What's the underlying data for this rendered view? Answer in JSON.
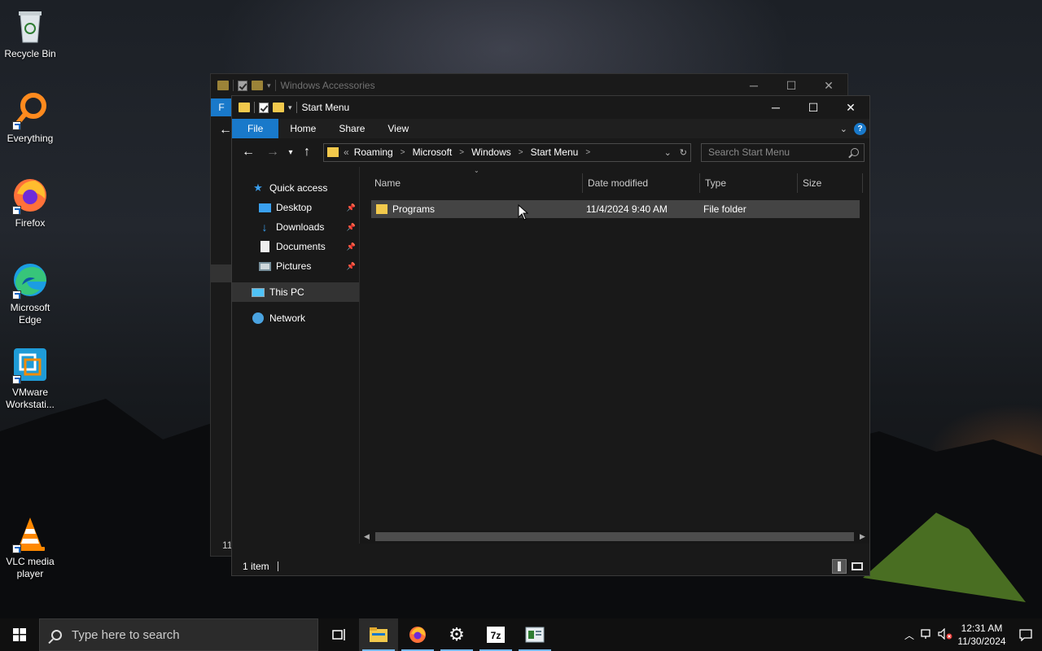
{
  "desktop": {
    "icons": [
      {
        "label": "Recycle Bin",
        "icon": "recycle-bin-icon"
      },
      {
        "label": "Everything",
        "icon": "everything-icon"
      },
      {
        "label": "Firefox",
        "icon": "firefox-icon"
      },
      {
        "label": "Microsoft Edge",
        "icon": "edge-icon"
      },
      {
        "label": "VMware Workstati...",
        "icon": "vmware-icon"
      },
      {
        "label": "VLC media player",
        "icon": "vlc-icon"
      }
    ]
  },
  "back_window": {
    "title": "Windows Accessories",
    "ribbon_file_initial": "F",
    "status_partial": "11"
  },
  "explorer": {
    "title": "Start Menu",
    "ribbon_tabs": [
      "File",
      "Home",
      "Share",
      "View"
    ],
    "help": "?",
    "breadcrumb_overflow": "«",
    "breadcrumb": [
      "Roaming",
      "Microsoft",
      "Windows",
      "Start Menu"
    ],
    "search_placeholder": "Search Start Menu",
    "nav": {
      "quick_access": "Quick access",
      "pinned": [
        "Desktop",
        "Downloads",
        "Documents",
        "Pictures"
      ],
      "this_pc": "This PC",
      "network": "Network"
    },
    "columns": [
      "Name",
      "Date modified",
      "Type",
      "Size"
    ],
    "rows": [
      {
        "name": "Programs",
        "date": "11/4/2024 9:40 AM",
        "type": "File folder",
        "size": ""
      }
    ],
    "status": "1 item"
  },
  "taskbar": {
    "search_placeholder": "Type here to search",
    "time": "12:31 AM",
    "date": "11/30/2024"
  },
  "colors": {
    "accent": "#1979ca",
    "folder": "#f2c94c",
    "window_bg": "#191919",
    "taskbar_bg": "#101010"
  }
}
